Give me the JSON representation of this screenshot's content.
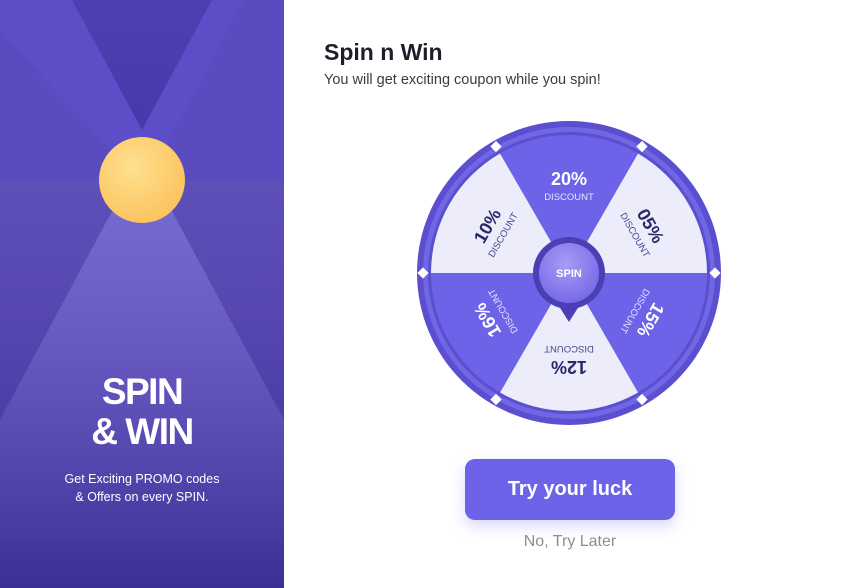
{
  "promo": {
    "title_line1": "SPIN",
    "title_line2": "& WIN",
    "subtitle_line1": "Get Exciting PROMO codes",
    "subtitle_line2": "& Offers on every SPIN."
  },
  "header": {
    "title": "Spin n Win",
    "subtitle": "You will get exciting coupon while you spin!"
  },
  "wheel": {
    "center_label": "SPIN",
    "segments": [
      {
        "value": "20%",
        "label": "DISCOUNT"
      },
      {
        "value": "05%",
        "label": "DISCOUNT"
      },
      {
        "value": "15%",
        "label": "DISCOUNT"
      },
      {
        "value": "12%",
        "label": "DISCOUNT"
      },
      {
        "value": "16%",
        "label": "DISCOUNT"
      },
      {
        "value": "10%",
        "label": "DISCOUNT"
      }
    ]
  },
  "actions": {
    "primary_label": "Try your luck",
    "secondary_label": "No, Try Later"
  },
  "colors": {
    "accent": "#6c63e8",
    "panel_dark": "#4a3aa8",
    "medal": "#ffcf6e",
    "segment_dark": "#6c63e8",
    "segment_light": "#ececfa"
  }
}
